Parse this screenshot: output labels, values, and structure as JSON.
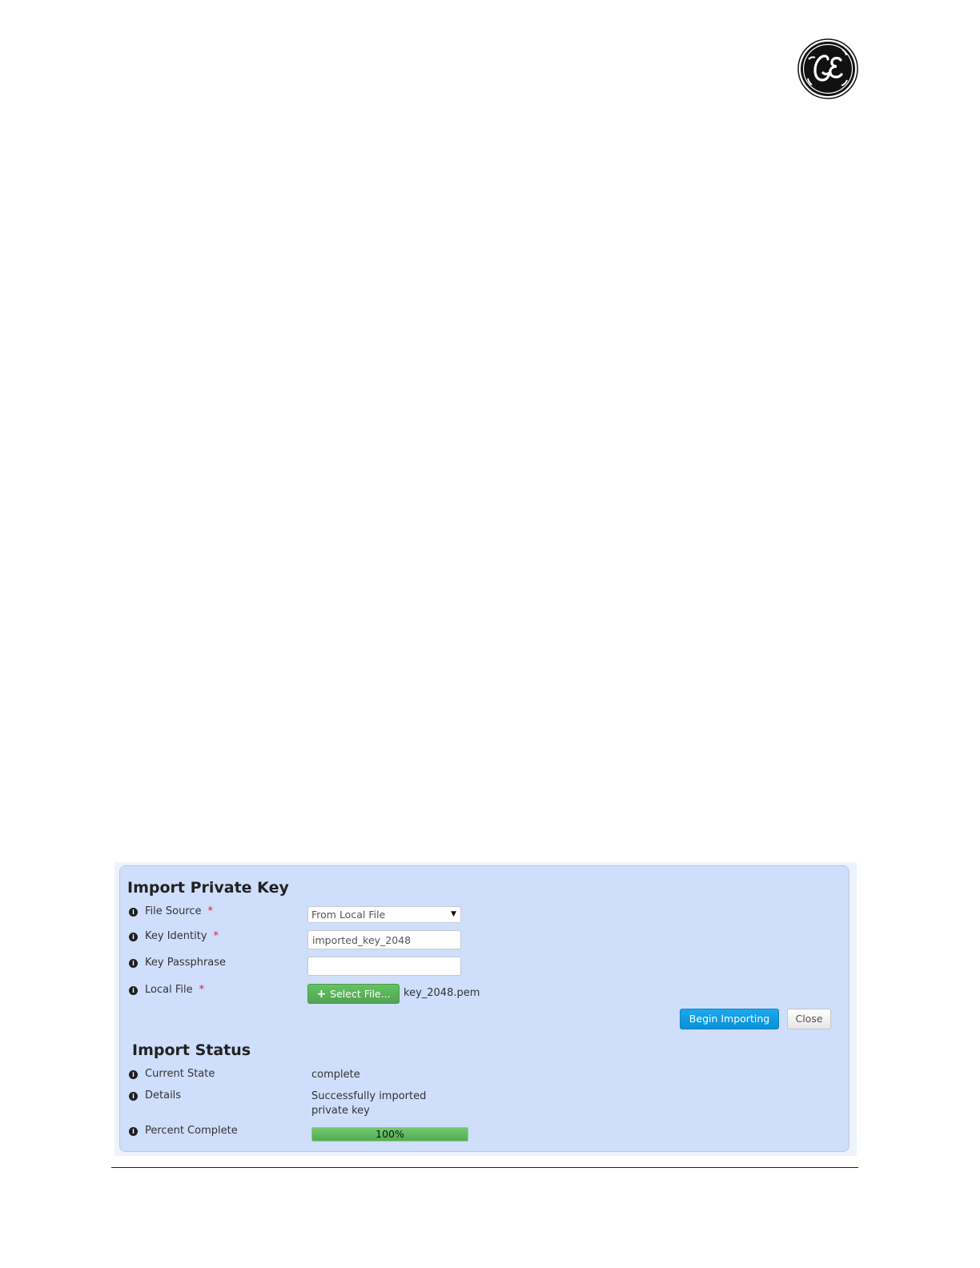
{
  "logo": {
    "brand": "GE",
    "icon": "ge-monogram-logo"
  },
  "import_form": {
    "title": "Import Private Key",
    "fields": {
      "file_source": {
        "label": "File Source",
        "required_marker": "*",
        "value": "From Local File"
      },
      "key_identity": {
        "label": "Key Identity",
        "required_marker": "*",
        "value": "imported_key_2048"
      },
      "key_passphrase": {
        "label": "Key Passphrase",
        "value": ""
      },
      "local_file": {
        "label": "Local File",
        "required_marker": "*",
        "button_label": "Select File...",
        "file_name": "key_2048.pem"
      }
    },
    "buttons": {
      "begin_label": "Begin Importing",
      "close_label": "Close"
    }
  },
  "import_status": {
    "title": "Import Status",
    "current_state": {
      "label": "Current State",
      "value": "complete"
    },
    "details": {
      "label": "Details",
      "value_line1": "Successfully imported",
      "value_line2": "private key"
    },
    "percent_complete": {
      "label": "Percent Complete",
      "value": 1.0,
      "text": "100%"
    }
  },
  "colors": {
    "panel_background": "#cfdefa",
    "primary_button": "#0a8fd8",
    "success_button": "#5cb85c",
    "required_marker": "#e01b1b",
    "progress_fill": "#4fae4f"
  }
}
